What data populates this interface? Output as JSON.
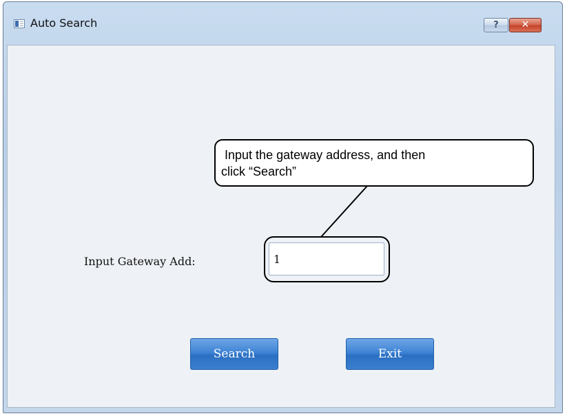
{
  "window": {
    "title": "Auto Search",
    "help_label": "?",
    "close_label": "✕"
  },
  "callout": {
    "text": " Input the gateway address, and then\nclick “Search”"
  },
  "form": {
    "gateway_label": "Input Gateway Add:",
    "gateway_value": "1"
  },
  "buttons": {
    "search_label": "Search",
    "exit_label": "Exit"
  },
  "colors": {
    "button_blue": "#3f84d4",
    "close_red": "#c5432a",
    "frame_blue": "#b9cfe8"
  }
}
